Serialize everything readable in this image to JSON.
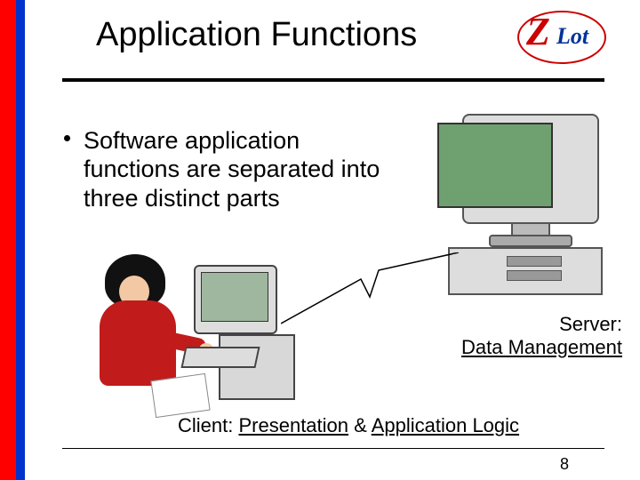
{
  "header": {
    "title": "Application Functions"
  },
  "logo": {
    "z": "Z",
    "lot": "Lot"
  },
  "bullet": {
    "text": "Software application functions are separated into three distinct parts"
  },
  "server": {
    "line1": "Server:",
    "line2": "Data Management"
  },
  "client": {
    "prefix": "Client: ",
    "part1": "Presentation",
    "amp": " & ",
    "part2": "Application Logic"
  },
  "page": {
    "num": "8"
  }
}
